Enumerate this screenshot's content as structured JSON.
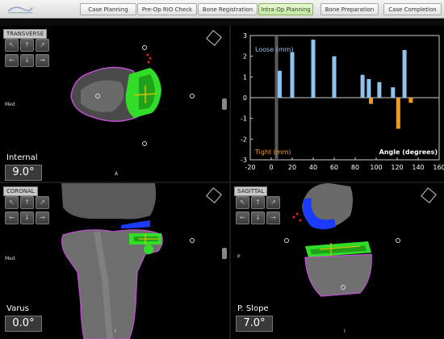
{
  "tabs": [
    {
      "label": "Case Planning",
      "active": false
    },
    {
      "label": "Pre-Op RIO Check",
      "active": false
    },
    {
      "label": "Bone Registration",
      "active": false
    },
    {
      "label": "Intra-Op Planning",
      "active": true
    },
    {
      "label": "Bone Preparation",
      "active": false
    },
    {
      "label": "Case Completion",
      "active": false
    }
  ],
  "views": {
    "transverse": {
      "title": "TRANSVERSE",
      "side_label": "Med",
      "bottom_label": "A",
      "measure_label": "Internal",
      "measure_value": "9.0°"
    },
    "coronal": {
      "title": "CORONAL",
      "side_label": "Med",
      "bottom_label": "I",
      "measure_label": "Varus",
      "measure_value": "0.0°"
    },
    "sagittal": {
      "title": "SAGITTAL",
      "side_label": "P",
      "bottom_label": "I",
      "measure_label": "P. Slope",
      "measure_value": "7.0°"
    }
  },
  "colors": {
    "implant": "#32dd2a",
    "bone_outline": "#c04fd0",
    "loose_bar": "#8fc3ef",
    "tight_bar": "#f39a1d",
    "active_tab": "#c8e7a6",
    "spacer_blue": "#1b3cff"
  },
  "chart_data": {
    "type": "bar",
    "xlabel": "Angle (degrees)",
    "ylabel_top": "Loose (mm)",
    "ylabel_bottom": "Tight (mm)",
    "xlim": [
      -20,
      160
    ],
    "ylim": [
      -3,
      3
    ],
    "xticks": [
      -20,
      0,
      20,
      40,
      60,
      80,
      100,
      120,
      140,
      160
    ],
    "yticks": [
      3,
      2,
      1,
      0,
      -1,
      -2,
      -3
    ],
    "current_angle": 5,
    "series": [
      {
        "name": "Loose (mm)",
        "color": "#8fc3ef",
        "x": [
          8,
          20,
          40,
          60,
          87,
          93,
          103,
          116,
          127
        ],
        "values": [
          1.3,
          2.2,
          2.8,
          2.0,
          1.1,
          0.9,
          0.75,
          0.5,
          2.3
        ]
      },
      {
        "name": "Tight (mm)",
        "color": "#f39a1d",
        "x": [
          95,
          121,
          133
        ],
        "values": [
          -0.3,
          -1.5,
          -0.25
        ]
      }
    ]
  }
}
